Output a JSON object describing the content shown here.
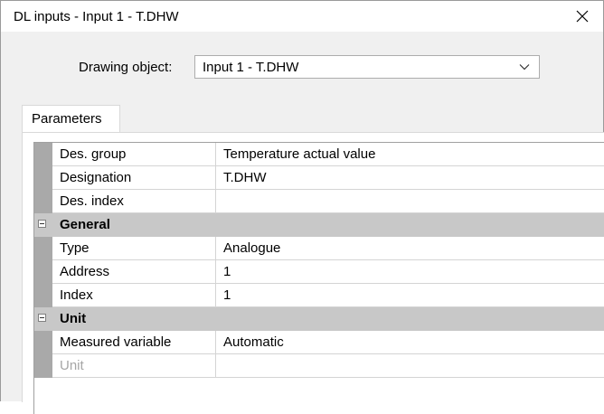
{
  "window": {
    "title": "DL inputs - Input 1 - T.DHW",
    "close_glyph": "✕"
  },
  "drawing_object": {
    "label": "Drawing object:",
    "value": "Input 1 - T.DHW"
  },
  "tabs": [
    {
      "label": "Parameters"
    }
  ],
  "grid": {
    "rows": [
      {
        "kind": "prop",
        "name": "Des. group",
        "value": "Temperature actual value"
      },
      {
        "kind": "prop",
        "name": "Designation",
        "value": "T.DHW"
      },
      {
        "kind": "prop",
        "name": "Des. index",
        "value": ""
      },
      {
        "kind": "category",
        "name": "General"
      },
      {
        "kind": "prop",
        "name": "Type",
        "value": "Analogue"
      },
      {
        "kind": "prop",
        "name": "Address",
        "value": "1"
      },
      {
        "kind": "prop",
        "name": "Index",
        "value": "1"
      },
      {
        "kind": "category",
        "name": "Unit"
      },
      {
        "kind": "prop",
        "name": "Measured variable",
        "value": "Automatic"
      },
      {
        "kind": "prop",
        "name": "Unit",
        "value": "",
        "disabled": true
      }
    ]
  }
}
